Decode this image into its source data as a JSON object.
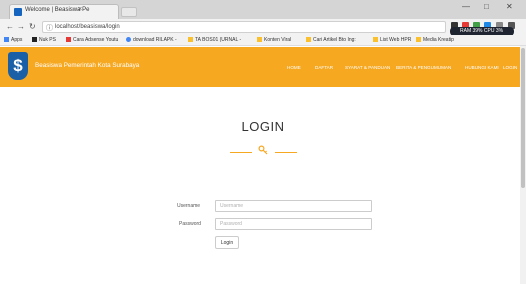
{
  "browser": {
    "tab_title": "Welcome | Beasiswa Pe",
    "tab_close": "×",
    "url": "localhost/beasiswa/login",
    "window_controls": [
      "—",
      "□",
      "✕"
    ],
    "system_widget": "RAM 39%   CPU 3%",
    "bookmarks": [
      {
        "label": "Apps",
        "color": "#4285f4"
      },
      {
        "label": "Nuk PS",
        "color": "#222222"
      },
      {
        "label": "Cara Adsense Youtu",
        "color": "#e53935"
      },
      {
        "label": "download RILAPK -",
        "color": "#4285f4"
      },
      {
        "label": "TA BOS01 (URNAL -",
        "color": "#fbc02d"
      },
      {
        "label": "Konten Viral",
        "color": "#fbc02d"
      },
      {
        "label": "Cari Artikel Bto Ing:",
        "color": "#fbc02d"
      },
      {
        "label": "List Web HPR",
        "color": "#fbc02d"
      },
      {
        "label": "Media Kreatip",
        "color": "#fbc02d"
      }
    ]
  },
  "site": {
    "title": "Beasiswa Pemerintah Kota Surabaya",
    "logo_glyph": "$",
    "menu": [
      "HOME",
      "DAFTAR",
      "SYARAT & PANDUAN",
      "BERITA & PENGUMUMAN",
      "HUBUNGI KAMI",
      "LOGIN"
    ],
    "colors": {
      "header": "#f6a821",
      "logo": "#1b5fa6"
    }
  },
  "login": {
    "heading": "LOGIN",
    "username_label": "Username",
    "username_placeholder": "Username",
    "password_label": "Password",
    "password_placeholder": "Password",
    "button_label": "Login"
  }
}
